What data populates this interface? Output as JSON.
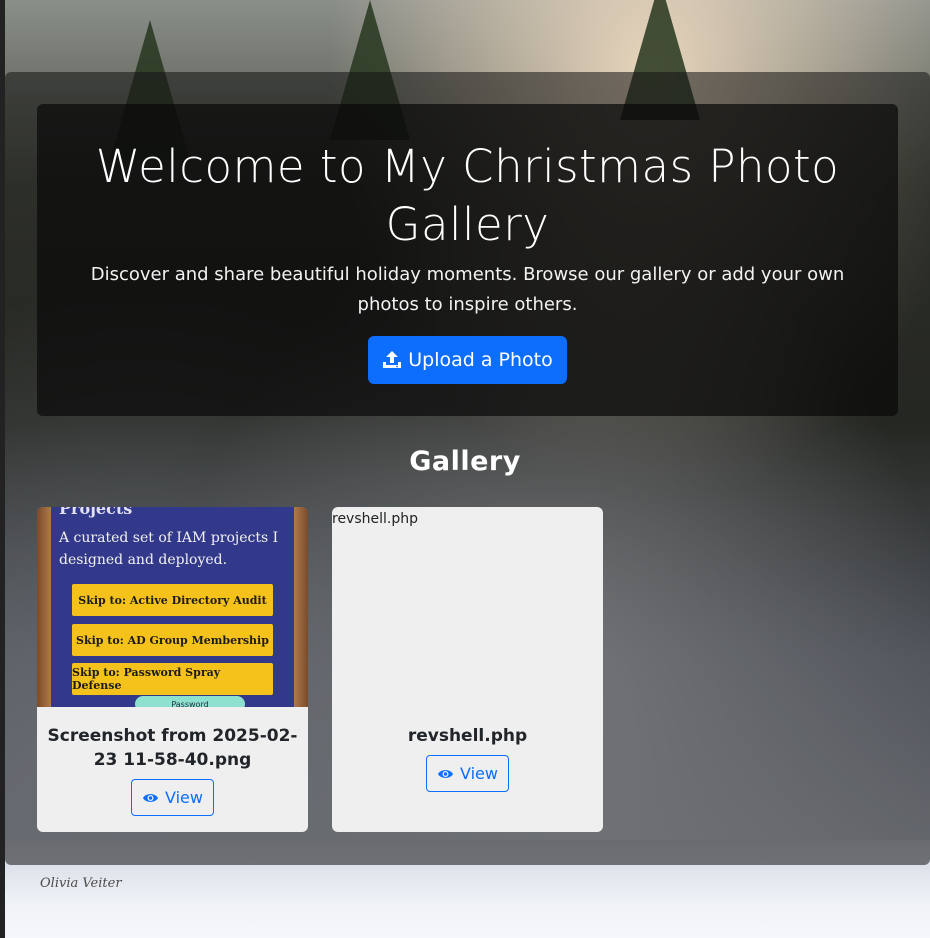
{
  "hero": {
    "title": "Welcome to My Christmas Photo Gallery",
    "subtitle": "Discover and share beautiful holiday moments. Browse our gallery or add your own photos to inspire others.",
    "upload_button_label": "Upload a Photo",
    "upload_icon": "upload-icon"
  },
  "gallery": {
    "title": "Gallery",
    "items": [
      {
        "title": "Screenshot from 2025-02-23 11-58-40.png",
        "view_label": "View",
        "view_icon": "eye-icon",
        "thumbnail": {
          "heading": "Projects",
          "description": "A curated set of IAM projects I designed and deployed.",
          "buttons": [
            "Skip to: Active Directory Audit",
            "Skip to: AD Group Membership",
            "Skip to: Password Spray Defense"
          ],
          "pill": "Password"
        }
      },
      {
        "title": "revshell.php",
        "alt_text": "revshell.php",
        "view_label": "View",
        "view_icon": "eye-icon"
      }
    ]
  },
  "background": {
    "signature": "Olivia Veiter"
  },
  "colors": {
    "primary": "#0d6efd",
    "card_bg": "#efefef",
    "hero_bg": "#0a0a0a"
  }
}
